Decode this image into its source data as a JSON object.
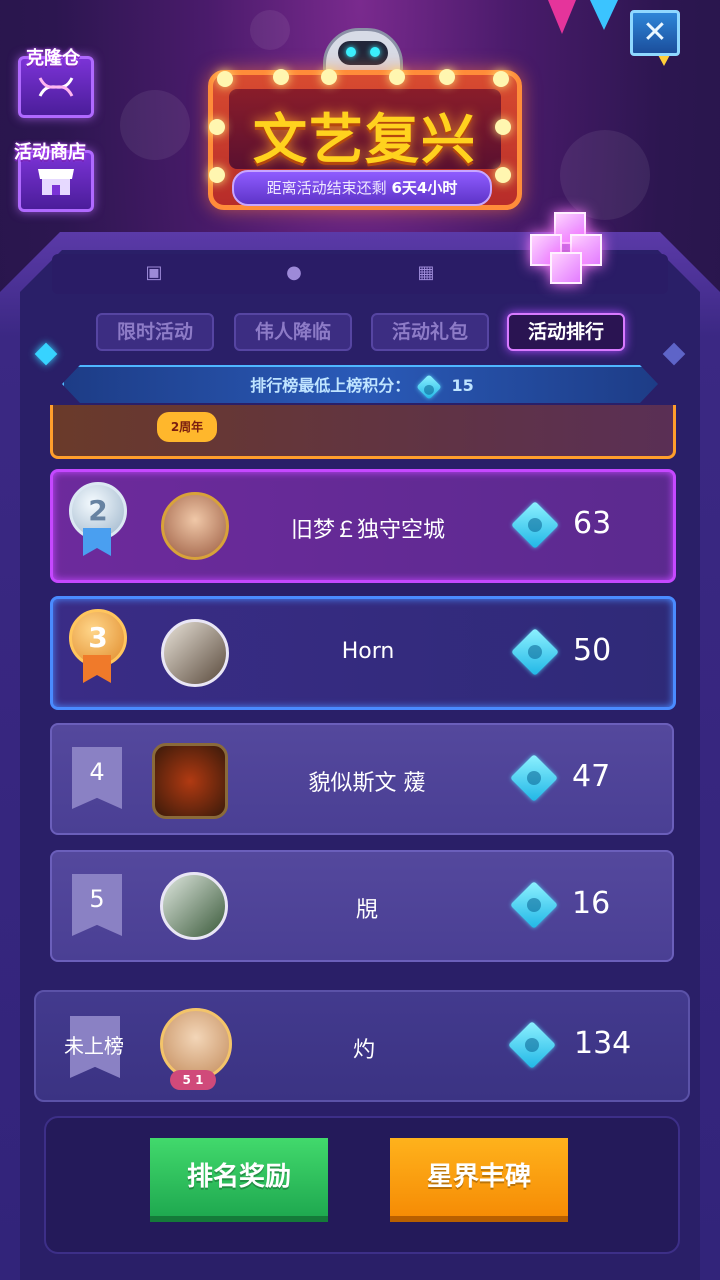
{
  "header": {
    "clone_warehouse_label": "克隆仓",
    "event_shop_label": "活动商店",
    "title": "文艺复兴",
    "countdown_prefix": "距离活动结束还剩",
    "countdown_value": "6天4小时",
    "close_symbol": "✕"
  },
  "tabs": [
    {
      "label": "限时活动",
      "active": false
    },
    {
      "label": "伟人降临",
      "active": false
    },
    {
      "label": "活动礼包",
      "active": false
    },
    {
      "label": "活动排行",
      "active": true
    }
  ],
  "banner": {
    "label": "排行榜最低上榜积分：",
    "value": "15"
  },
  "ranking": [
    {
      "rank": "2",
      "name": "旧梦￡独守空城",
      "score": "63",
      "style": "silver"
    },
    {
      "rank": "3",
      "name": "Horn",
      "score": "50",
      "style": "bronze"
    },
    {
      "rank": "4",
      "name": "貌似斯文 蕿",
      "score": "47",
      "style": "plain"
    },
    {
      "rank": "5",
      "name": "覑",
      "score": "16",
      "style": "plain"
    }
  ],
  "self": {
    "rank_label": "未上榜",
    "name": "灼",
    "score": "134",
    "badge": "5 1"
  },
  "partial_row": {
    "badge_text": "2周年"
  },
  "buttons": {
    "rank_reward": "排名奖励",
    "star_monument": "星界丰碑"
  },
  "colors": {
    "accent_gem": "#37d3ff",
    "active_tab_border": "#d87aff",
    "green_button": "#1fa950",
    "orange_button": "#f68c05"
  }
}
